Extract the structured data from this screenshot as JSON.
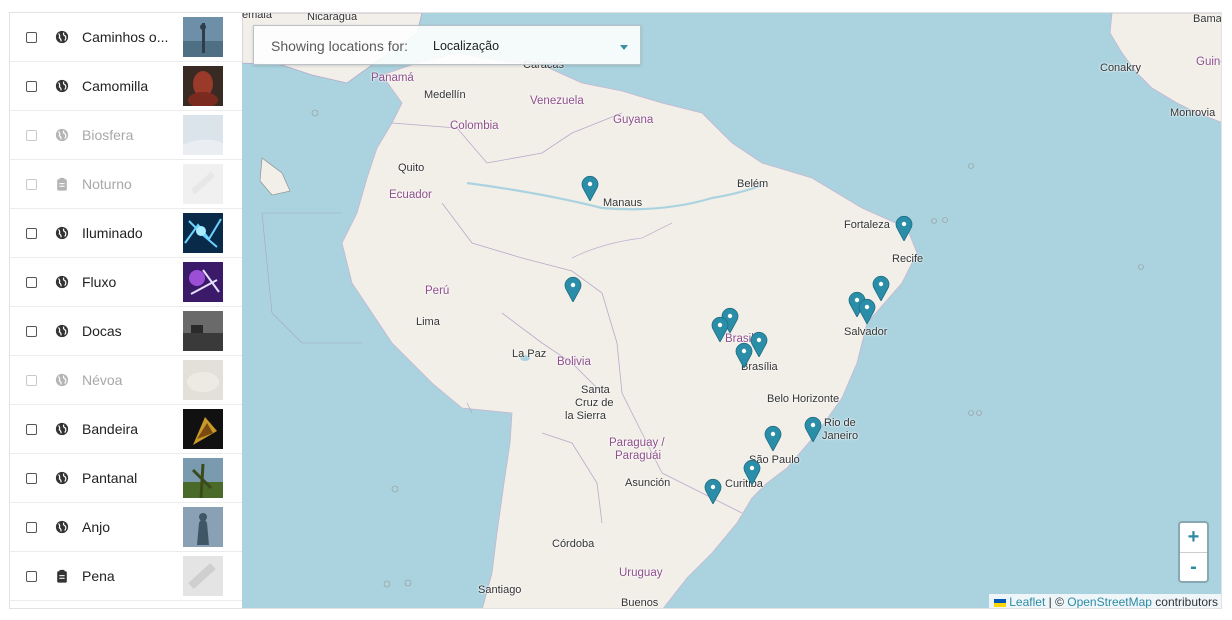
{
  "sidebar": {
    "items": [
      {
        "label": "Caminhos o...",
        "icon": "globe-icon",
        "disabled": false
      },
      {
        "label": "Camomilla",
        "icon": "globe-icon",
        "disabled": false
      },
      {
        "label": "Biosfera",
        "icon": "globe-icon",
        "disabled": true
      },
      {
        "label": "Noturno",
        "icon": "clipboard-icon",
        "disabled": true
      },
      {
        "label": "Iluminado",
        "icon": "globe-icon",
        "disabled": false
      },
      {
        "label": "Fluxo",
        "icon": "globe-icon",
        "disabled": false
      },
      {
        "label": "Docas",
        "icon": "globe-icon",
        "disabled": false
      },
      {
        "label": "Névoa",
        "icon": "globe-icon",
        "disabled": true
      },
      {
        "label": "Bandeira",
        "icon": "globe-icon",
        "disabled": false
      },
      {
        "label": "Pantanal",
        "icon": "globe-icon",
        "disabled": false
      },
      {
        "label": "Anjo",
        "icon": "globe-icon",
        "disabled": false
      },
      {
        "label": "Pena",
        "icon": "clipboard-icon",
        "disabled": false
      }
    ]
  },
  "filter": {
    "label": "Showing locations for:",
    "value": "Localização"
  },
  "map": {
    "labels": {
      "nicaragua": "Nicaragua",
      "panama": "Panamá",
      "medellin": "Medellín",
      "colombia": "Colombia",
      "caracas": "Caracas",
      "venezuela": "Venezuela",
      "guyana": "Guyana",
      "quito": "Quito",
      "ecuador": "Ecuador",
      "manaus": "Manaus",
      "belem": "Belém",
      "fortaleza": "Fortaleza",
      "recife": "Recife",
      "peru": "Perú",
      "lima": "Lima",
      "lapaz": "La Paz",
      "bolivia": "Bolivia",
      "brasil": "Brasil",
      "brasilia": "Brasília",
      "salvador": "Salvador",
      "santacruz1": "Santa",
      "santacruz2": "Cruz de",
      "santacruz3": "la Sierra",
      "belohorizonte": "Belo Horizonte",
      "riodejaneiro1": "Rio de",
      "riodejaneiro2": "Janeiro",
      "saopaulo": "São Paulo",
      "paraguay1": "Paraguay /",
      "paraguay2": "Paraguái",
      "asuncion": "Asunción",
      "curitiba": "Curitiba",
      "cordoba": "Córdoba",
      "uruguay": "Uruguay",
      "santiago": "Santiago",
      "buenos": "Buenos",
      "guinee": "Guinée",
      "conakry": "Conakry",
      "monrovia": "Monrovia",
      "bama": "Bama",
      "guatemala": "emala"
    },
    "marker_color": "#2b8ea8",
    "zoom_in": "+",
    "zoom_out": "-"
  },
  "attribution": {
    "leaflet": "Leaflet",
    "sep": " | © ",
    "osm": "OpenStreetMap",
    "contrib": " contributors"
  }
}
